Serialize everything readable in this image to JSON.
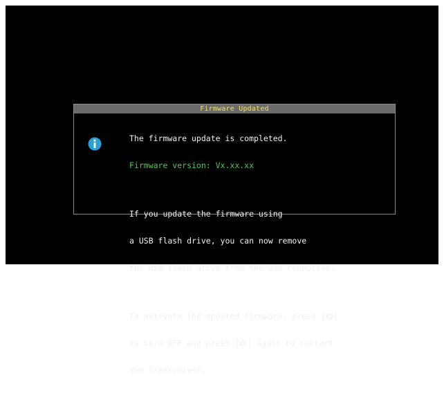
{
  "dialog": {
    "title": "Firmware Updated",
    "icon": "info-icon",
    "status_line": "The firmware update is completed.",
    "version_line": "Firmware version: Vx.xx.xx",
    "usb_lines": [
      "If you update the firmware using",
      "a USB flash drive, you can now remove",
      "the USB flash drive from the USB connector."
    ],
    "activate": {
      "l1_pre": "To activate the updated firmware, press [",
      "l1_post": "]",
      "l2_pre": "to turn OFF and press [",
      "l2_post": "] again to restart",
      "l3": "the transceiver."
    },
    "power_icon": "power-icon"
  },
  "colors": {
    "background": "#000000",
    "title_bar": "#6b6b6b",
    "title_text": "#f2e25a",
    "body_text": "#f0f0f0",
    "version_text": "#4ccc4c",
    "info_icon": "#2a9fd8"
  }
}
